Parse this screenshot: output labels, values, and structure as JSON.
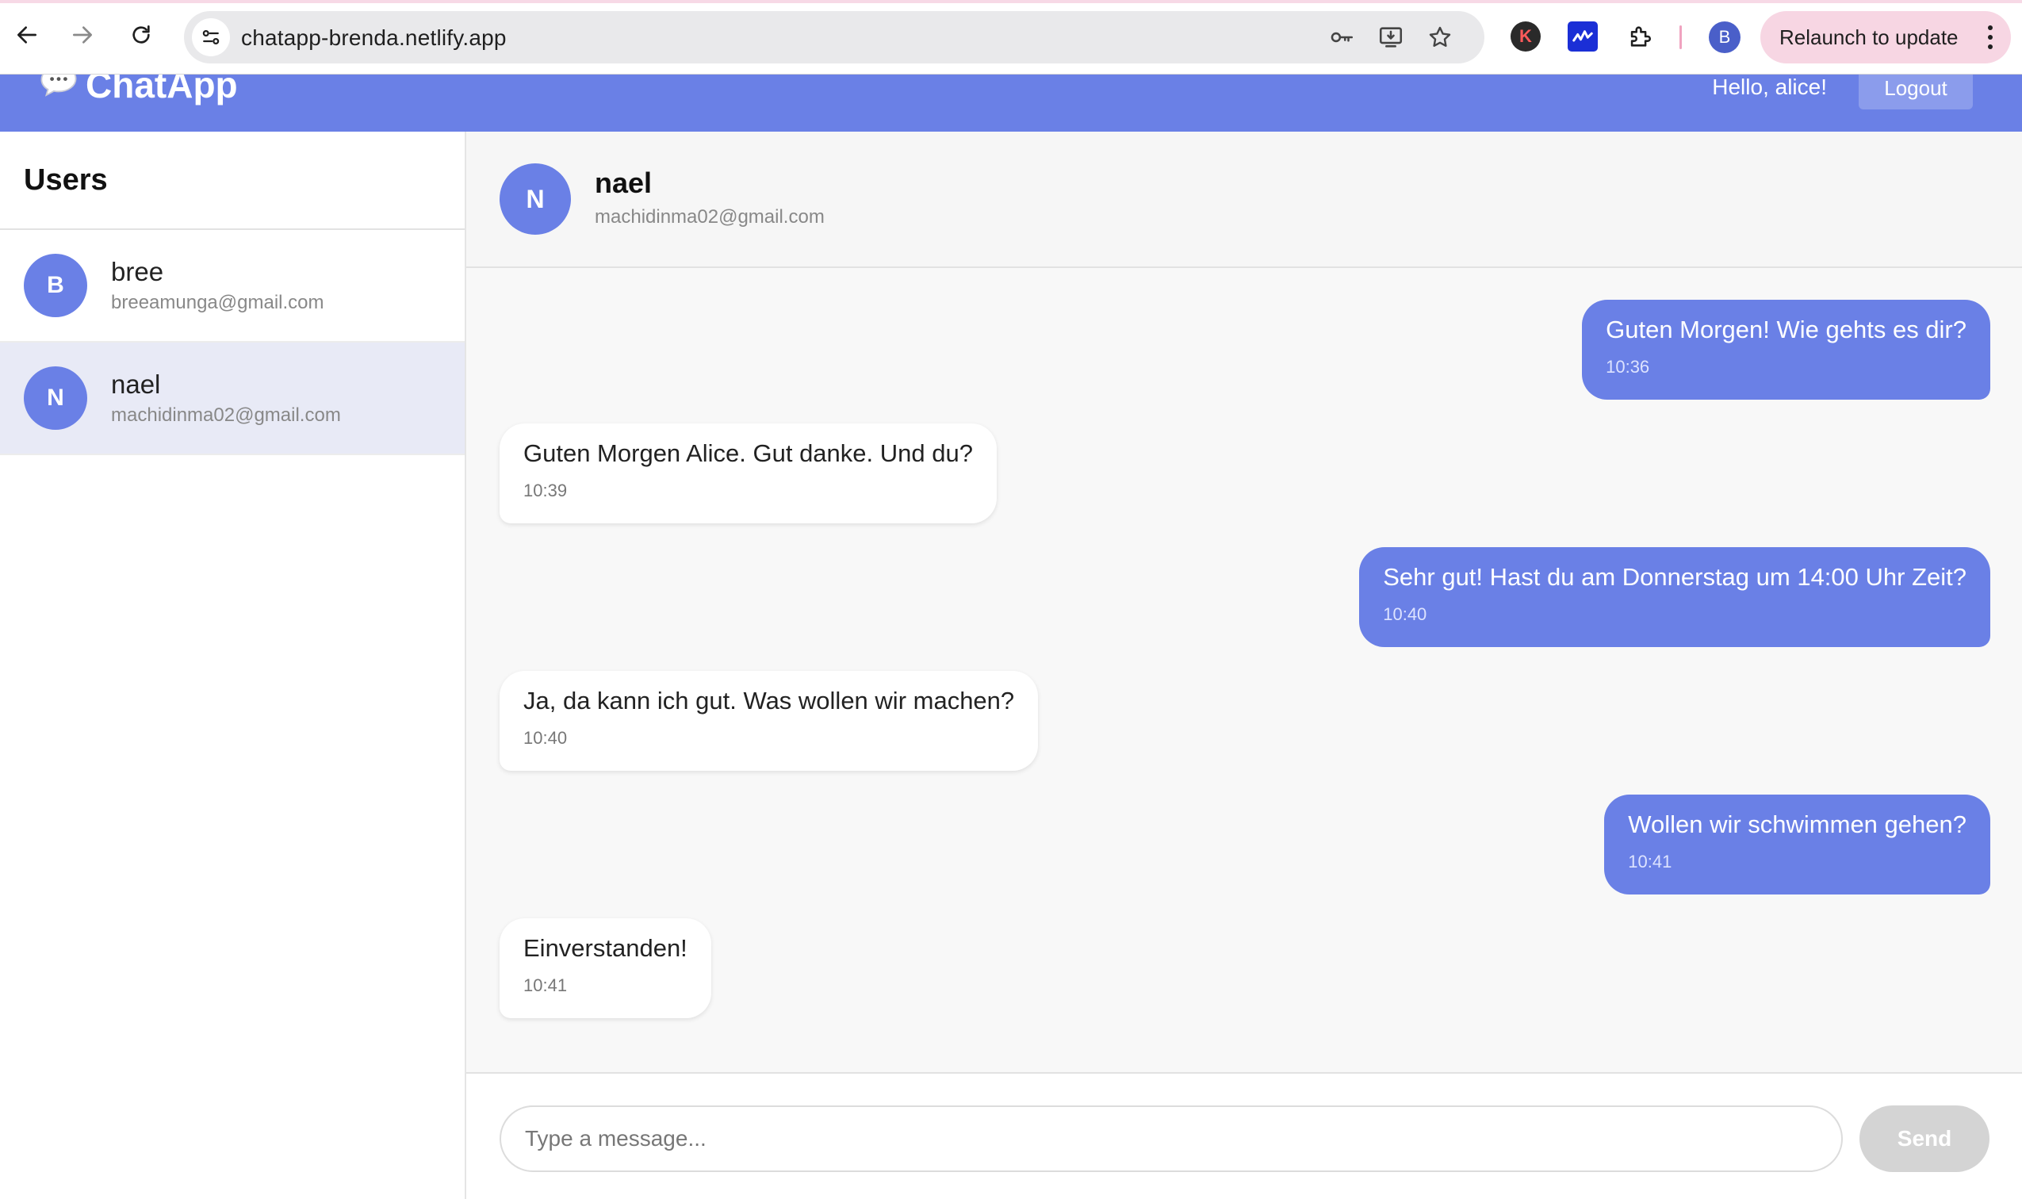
{
  "browser": {
    "url": "chatapp-brenda.netlify.app",
    "profile_initial": "B",
    "extension_k_label": "K",
    "relaunch_label": "Relaunch to update",
    "icons": [
      "back-arrow-icon",
      "forward-arrow-icon",
      "reload-icon",
      "site-info-icon",
      "password-key-icon",
      "install-app-icon",
      "bookmark-star-icon",
      "puzzle-extensions-icon",
      "kebab-menu-icon"
    ],
    "colors": {
      "relaunch_bg": "#f7d6e3",
      "profile_bg": "#4a5fc9"
    }
  },
  "header": {
    "app_name": "ChatApp",
    "greeting": "Hello, alice!",
    "logout_label": "Logout",
    "colors": {
      "brand": "#6a80e6"
    }
  },
  "sidebar": {
    "title": "Users",
    "users": [
      {
        "initial": "B",
        "name": "bree",
        "email": "breeamunga@gmail.com",
        "selected": false
      },
      {
        "initial": "N",
        "name": "nael",
        "email": "machidinma02@gmail.com",
        "selected": true
      }
    ]
  },
  "chat": {
    "contact": {
      "initial": "N",
      "name": "nael",
      "email": "machidinma02@gmail.com"
    },
    "messages": [
      {
        "direction": "sent",
        "text": "Guten Morgen! Wie gehts es dir?",
        "time": "10:36"
      },
      {
        "direction": "received",
        "text": "Guten Morgen Alice. Gut danke. Und du?",
        "time": "10:39"
      },
      {
        "direction": "sent",
        "text": "Sehr gut! Hast du am Donnerstag um 14:00 Uhr Zeit?",
        "time": "10:40"
      },
      {
        "direction": "received",
        "text": "Ja, da kann ich gut. Was wollen wir machen?",
        "time": "10:40"
      },
      {
        "direction": "sent",
        "text": "Wollen wir schwimmen gehen?",
        "time": "10:41"
      },
      {
        "direction": "received",
        "text": "Einverstanden!",
        "time": "10:41"
      }
    ],
    "composer": {
      "placeholder": "Type a message...",
      "value": "",
      "send_label": "Send"
    }
  }
}
